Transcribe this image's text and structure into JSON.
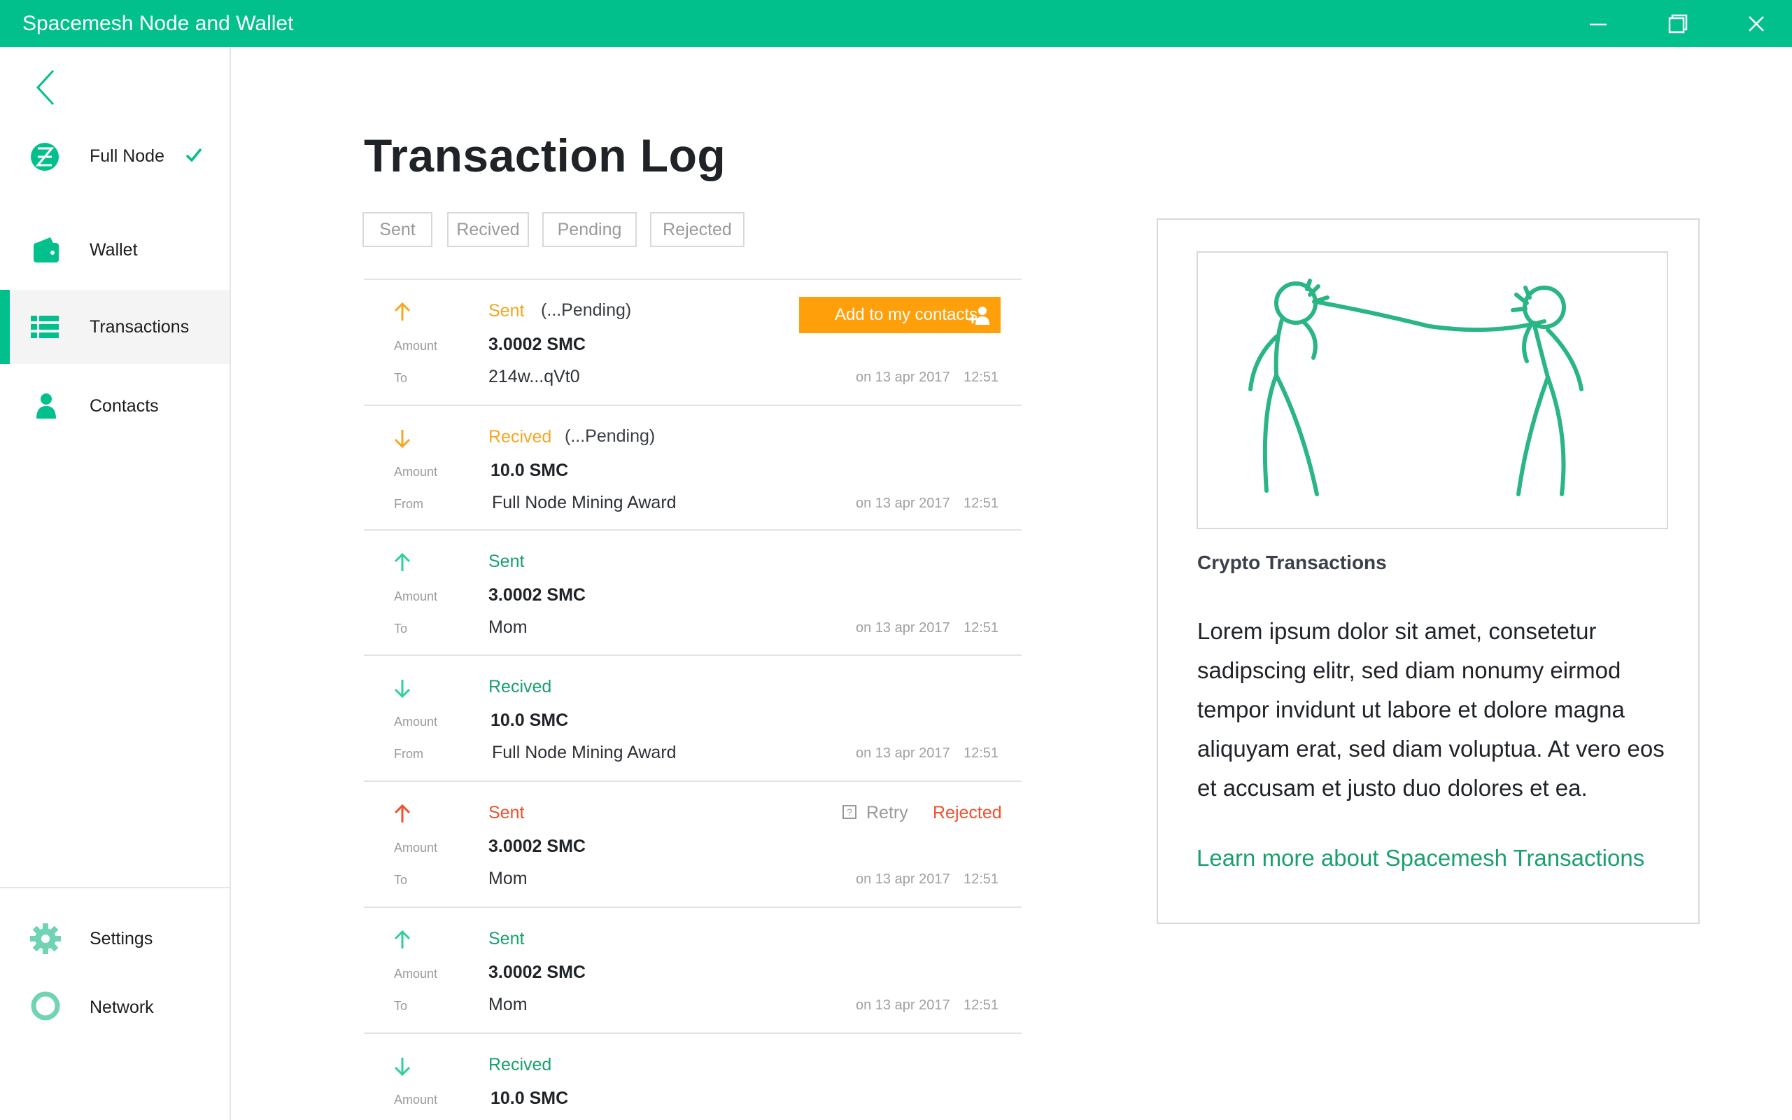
{
  "window": {
    "title": "Spacemesh Node and Wallet",
    "accent": "#02c08c"
  },
  "sidebar": {
    "back_icon": "chevron-left-icon",
    "items": [
      {
        "label": "Full Node",
        "icon": "spacemesh-logo-icon",
        "checked": true
      },
      {
        "label": "Wallet",
        "icon": "wallet-icon"
      },
      {
        "label": "Transactions",
        "icon": "list-icon",
        "active": true
      },
      {
        "label": "Contacts",
        "icon": "person-icon"
      },
      {
        "label": "Settings",
        "icon": "gear-icon"
      },
      {
        "label": "Network",
        "icon": "ring-icon"
      }
    ]
  },
  "main": {
    "title": "Transaction Log",
    "filters": [
      "Sent",
      "Recived",
      "Pending",
      "Rejected"
    ],
    "transactions": [
      {
        "direction": "up",
        "status": "Sent",
        "note": "(...Pending)",
        "amount_label": "Amount",
        "amount": "3.0002 SMC",
        "party_label": "To",
        "party": "214w...qVt0",
        "date": "on 13 apr 2017",
        "time": "12:51",
        "action": "Add to my contacts",
        "color": "#f5a623"
      },
      {
        "direction": "down",
        "status": "Recived",
        "note": "(...Pending)",
        "amount_label": "Amount",
        "amount": "10.0 SMC",
        "party_label": "From",
        "party": "Full Node Mining Award",
        "date": "on 13 apr 2017",
        "time": "12:51",
        "color": "#f5a623"
      },
      {
        "direction": "up",
        "status": "Sent",
        "amount_label": "Amount",
        "amount": "3.0002 SMC",
        "party_label": "To",
        "party": "Mom",
        "date": "on 13 apr 2017",
        "time": "12:51",
        "color": "#1aa06d"
      },
      {
        "direction": "down",
        "status": "Recived",
        "amount_label": "Amount",
        "amount": "10.0 SMC",
        "party_label": "From",
        "party": "Full Node Mining Award",
        "date": "on 13 apr 2017",
        "time": "12:51",
        "color": "#1aa06d"
      },
      {
        "direction": "up",
        "status": "Sent",
        "amount_label": "Amount",
        "amount": "3.0002 SMC",
        "party_label": "To",
        "party": "Mom",
        "date": "on 13 apr 2017",
        "time": "12:51",
        "retry": "Retry",
        "rejected": "Rejected",
        "color": "#f0502d"
      },
      {
        "direction": "up",
        "status": "Sent",
        "amount_label": "Amount",
        "amount": "3.0002 SMC",
        "party_label": "To",
        "party": "Mom",
        "date": "on 13 apr 2017",
        "time": "12:51",
        "color": "#1aa06d"
      },
      {
        "direction": "down",
        "status": "Recived",
        "amount_label": "Amount",
        "amount": "10.0 SMC",
        "color": "#1aa06d"
      }
    ]
  },
  "info_card": {
    "title": "Crypto Transactions",
    "body": "Lorem ipsum dolor sit amet, consetetur sadipscing elitr, sed diam nonumy eirmod tempor invidunt ut labore et dolore magna aliquyam erat, sed diam voluptua. At vero eos et accusam et justo duo dolores et ea.",
    "link": "Learn more about Spacemesh Transactions"
  }
}
